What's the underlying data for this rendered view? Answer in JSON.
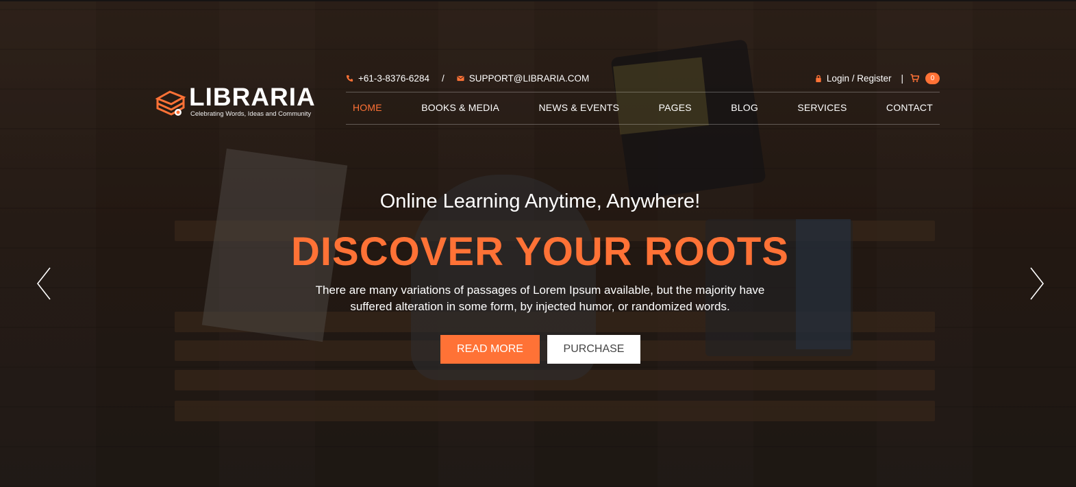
{
  "brand": {
    "name": "LIBRARIA",
    "tagline": "Celebrating Words, Ideas and Community",
    "logo_icon": "stacked-books-logo",
    "accent_color": "#ff7236"
  },
  "topbar": {
    "phone": "+61-3-8376-6284",
    "phone_icon": "phone-icon",
    "separator": "/",
    "email": "SUPPORT@LIBRARIA.COM",
    "email_icon": "envelope-icon",
    "login_label": "Login / Register",
    "login_icon": "lock-icon",
    "divider": "|",
    "cart_icon": "cart-icon",
    "cart_count": "0"
  },
  "nav": {
    "items": [
      {
        "label": "HOME",
        "active": true
      },
      {
        "label": "BOOKS & MEDIA",
        "active": false
      },
      {
        "label": "NEWS & EVENTS",
        "active": false
      },
      {
        "label": "PAGES",
        "active": false
      },
      {
        "label": "BLOG",
        "active": false
      },
      {
        "label": "SERVICES",
        "active": false
      },
      {
        "label": "CONTACT",
        "active": false
      }
    ]
  },
  "slide": {
    "subtitle": "Online Learning Anytime, Anywhere!",
    "title": "DISCOVER YOUR ROOTS",
    "description_line1": "There are many variations of passages of Lorem Ipsum available, but the majority have",
    "description_line2": "suffered alteration in some form, by injected humor, or randomized words.",
    "primary_button": "READ MORE",
    "secondary_button": "PURCHASE",
    "prev_icon": "chevron-left-icon",
    "next_icon": "chevron-right-icon"
  }
}
